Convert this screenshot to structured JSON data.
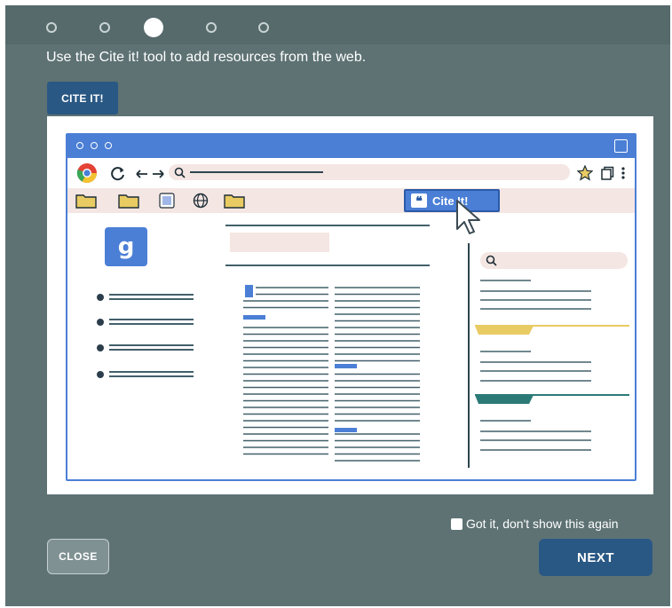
{
  "stepper": {
    "total": 5,
    "current": 3
  },
  "instruction": "Use the Cite it! tool to add resources from the web.",
  "cite_button": "CITE IT!",
  "illustration": {
    "cite_popup_label": "Cite It!",
    "google_icon": "g"
  },
  "footer": {
    "checkbox_label": "Got it, don't show this again",
    "close_label": "CLOSE",
    "next_label": "NEXT"
  },
  "colors": {
    "modal_bg": "#5e7274",
    "primary_button": "#2a5884",
    "browser_blue": "#4b7fd6",
    "accent_yellow": "#e9cb63",
    "accent_teal": "#2b7a78"
  }
}
